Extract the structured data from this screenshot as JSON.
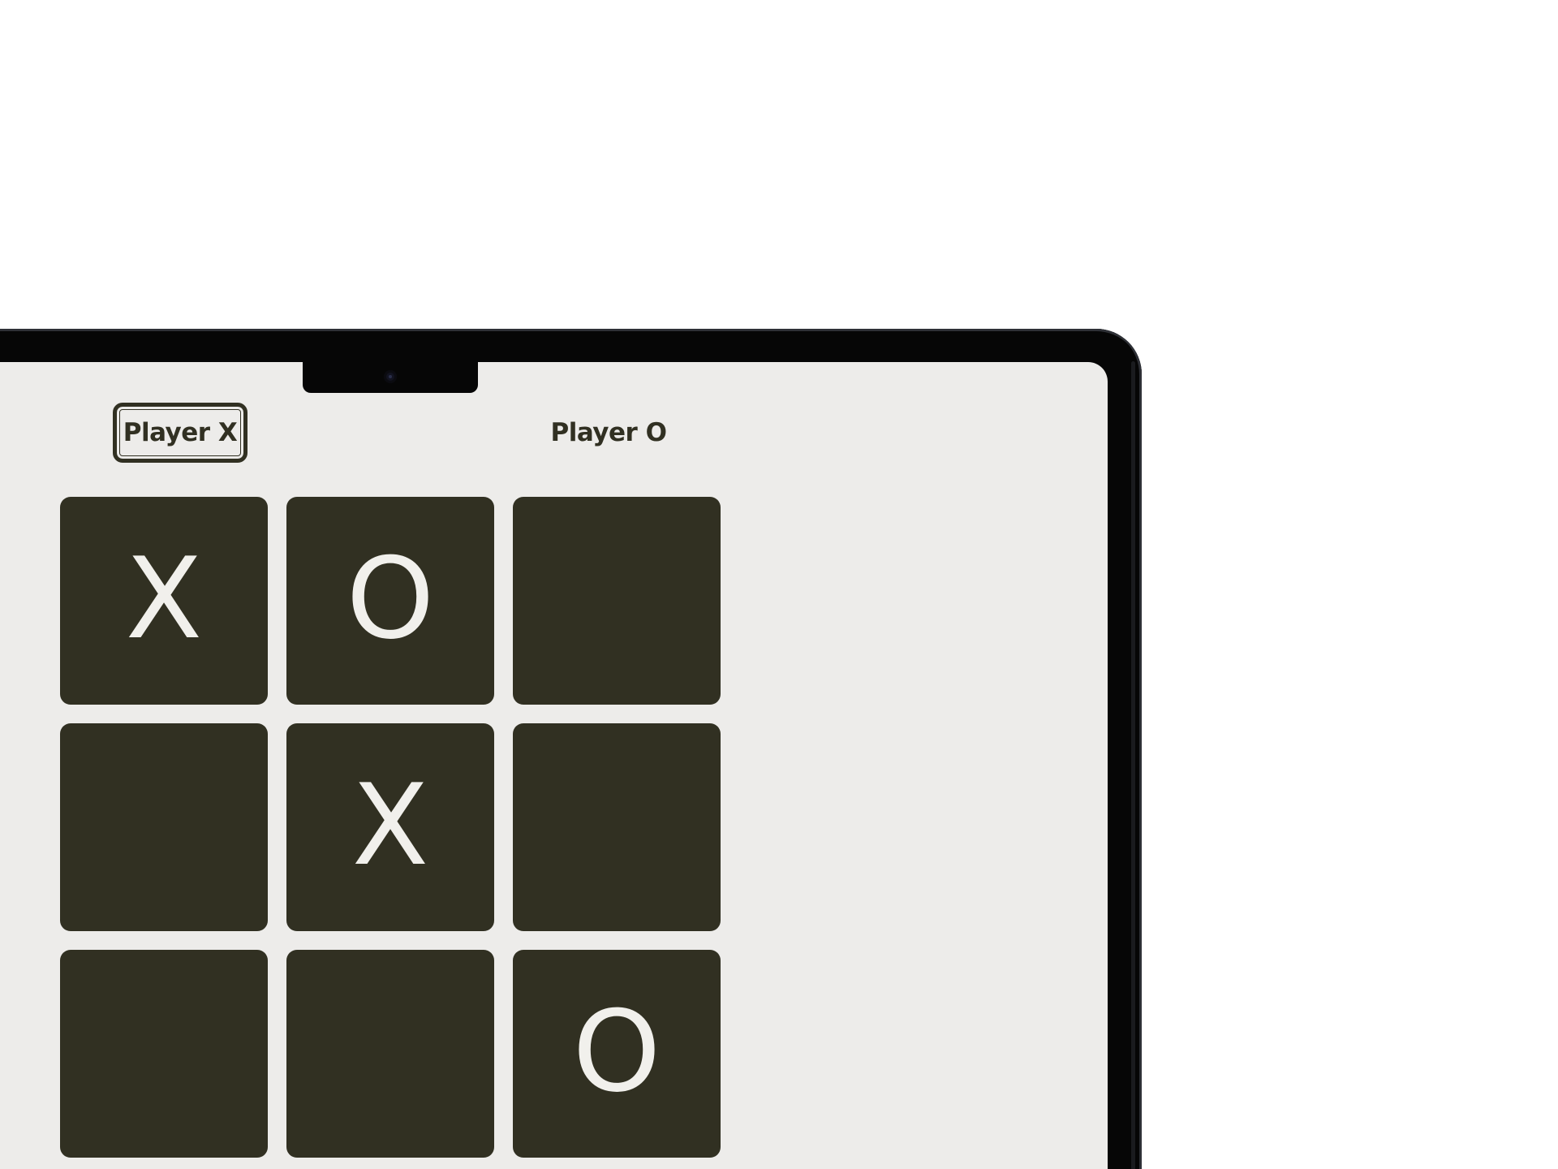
{
  "players": {
    "x_label": "Player X",
    "o_label": "Player O",
    "current": "X"
  },
  "board": {
    "cells": [
      "X",
      "O",
      "",
      "",
      "X",
      "",
      "",
      "",
      "O"
    ]
  },
  "colors": {
    "cell_background": "#313022",
    "mark_color": "#f1f0ec",
    "screen_background": "#edecea",
    "frame": "#060606"
  }
}
